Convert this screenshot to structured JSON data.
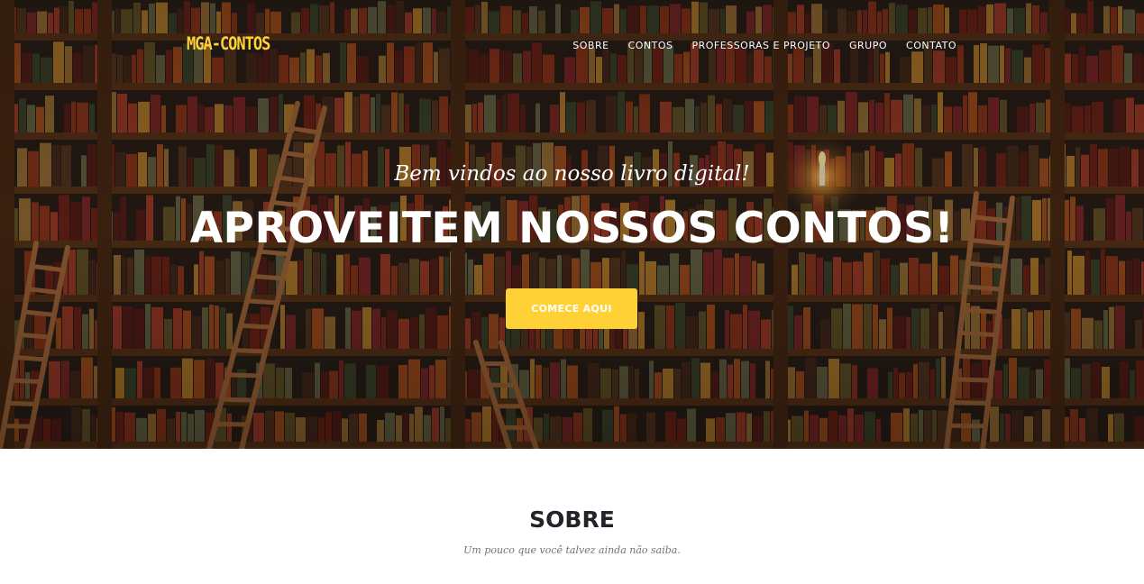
{
  "brand": {
    "name": "MGA-CONTOS",
    "color": "#fed136"
  },
  "nav": {
    "items": [
      {
        "label": "SOBRE"
      },
      {
        "label": "CONTOS"
      },
      {
        "label": "PROFESSORAS E PROJETO"
      },
      {
        "label": "GRUPO"
      },
      {
        "label": "CONTATO"
      }
    ]
  },
  "hero": {
    "subtitle": "Bem vindos ao nosso livro digital!",
    "title": "APROVEITEM NOSSOS CONTOS!",
    "cta_label": "COMECE AQUI",
    "cta_color": "#fed136",
    "background": "library-bookshelves-image"
  },
  "about": {
    "heading": "SOBRE",
    "subheading": "Um pouco que você talvez ainda não saiba."
  }
}
